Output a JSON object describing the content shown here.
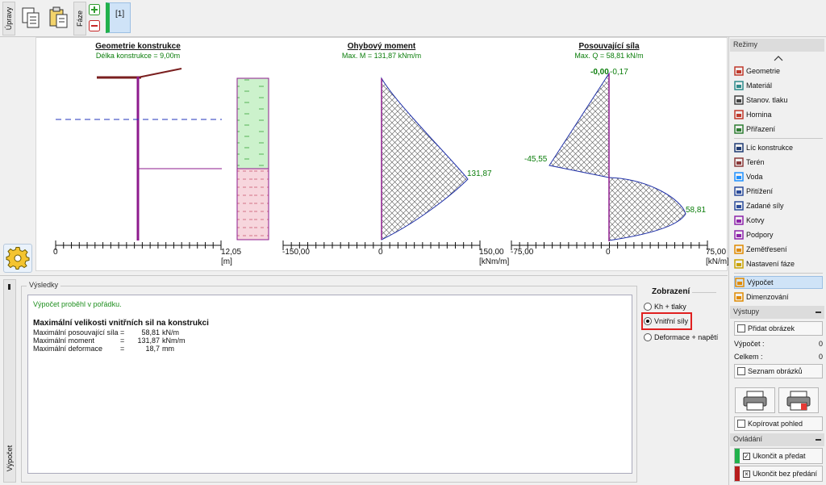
{
  "toolbar": {
    "upravy_tab": "Úpravy",
    "faze_tab": "Fáze",
    "phase_label": "[1]"
  },
  "charts": {
    "geometry": {
      "title": "Geometrie konstrukce",
      "subtitle": "Délka konstrukce = 9,00m",
      "axis_start": "0",
      "axis_end": "12,05",
      "unit": "[m]"
    },
    "moment": {
      "title": "Ohybový moment",
      "subtitle": "Max. M = 131,87 kNm/m",
      "axis_min": "-150,00",
      "axis_zero": "0",
      "axis_max": "150,00",
      "unit": "[kNm/m]",
      "peak_label": "131,87"
    },
    "shear": {
      "title": "Posouvající síla",
      "subtitle": "Max. Q = 58,81 kN/m",
      "axis_min": "-75,00",
      "axis_zero": "0",
      "axis_max": "75,00",
      "unit": "[kN/m]",
      "top_label_a": "-0,00",
      "top_label_b": "-0,17",
      "min_label": "-45,55",
      "max_label": "58,81"
    }
  },
  "chart_data": [
    {
      "type": "area",
      "title": "Ohybový moment",
      "xlabel": "[kNm/m]",
      "xlim": [
        -150,
        150
      ],
      "peak": 131.87
    },
    {
      "type": "area",
      "title": "Posouvající síla",
      "xlabel": "[kN/m]",
      "xlim": [
        -75,
        75
      ],
      "points": [
        -0.17,
        -45.55,
        58.81
      ]
    }
  ],
  "results": {
    "vtab": "Výpočet",
    "legend": "Výsledky",
    "success": "Výpočet proběhl v pořádku.",
    "heading": "Maximální velikosti vnitřních sil na konstrukci",
    "rows": [
      {
        "label": "Maximální posouvající síla",
        "eq": "=",
        "value": "58,81",
        "unit": "kN/m"
      },
      {
        "label": "Maximální moment",
        "eq": "=",
        "value": "131,87",
        "unit": "kNm/m"
      },
      {
        "label": "Maximální deformace",
        "eq": "=",
        "value": "18,7",
        "unit": "mm"
      }
    ]
  },
  "display": {
    "title": "Zobrazení",
    "options": [
      "Kh + tlaky",
      "Vnitřní síly",
      "Deformace + napětí"
    ],
    "selected": "Vnitřní síly"
  },
  "panel": {
    "modes_header": "Režimy",
    "items": [
      {
        "label": "Geometrie",
        "icon": "geometry-icon",
        "color": "#c0392b"
      },
      {
        "label": "Materiál",
        "icon": "material-icon",
        "color": "#2e8b8b"
      },
      {
        "label": "Stanov. tlaku",
        "icon": "pressure-icon",
        "color": "#444444"
      },
      {
        "label": "Hornina",
        "icon": "soil-icon",
        "color": "#c0392b"
      },
      {
        "label": "Přiřazení",
        "icon": "assign-icon",
        "color": "#2e7d32"
      },
      {
        "label": "Líc konstrukce",
        "icon": "face-icon",
        "color": "#1f3b73"
      },
      {
        "label": "Terén",
        "icon": "terrain-icon",
        "color": "#8b3a3a"
      },
      {
        "label": "Voda",
        "icon": "water-icon",
        "color": "#1e90ff"
      },
      {
        "label": "Přitížení",
        "icon": "surcharge-icon",
        "color": "#2b4c9b"
      },
      {
        "label": "Zadané síly",
        "icon": "forces-icon",
        "color": "#2b4c9b"
      },
      {
        "label": "Kotvy",
        "icon": "anchors-icon",
        "color": "#8e24aa"
      },
      {
        "label": "Podpory",
        "icon": "supports-icon",
        "color": "#8e24aa"
      },
      {
        "label": "Zemětřesení",
        "icon": "earthquake-icon",
        "color": "#e08a00"
      },
      {
        "label": "Nastavení fáze",
        "icon": "phase-settings-icon",
        "color": "#c9a200"
      },
      {
        "label": "Výpočet",
        "icon": "calculation-icon",
        "color": "#e08a00"
      },
      {
        "label": "Dimenzování",
        "icon": "design-icon",
        "color": "#e08a00"
      }
    ],
    "outputs_header": "Výstupy",
    "add_picture": "Přidat obrázek",
    "calc_label": "Výpočet :",
    "calc_count": "0",
    "total_label": "Celkem :",
    "total_count": "0",
    "list_pictures": "Seznam obrázků",
    "copy_view": "Kopírovat pohled",
    "control_header": "Ovládání",
    "finish_pass": "Ukončit a předat",
    "finish_nopass": "Ukončit bez předání"
  }
}
